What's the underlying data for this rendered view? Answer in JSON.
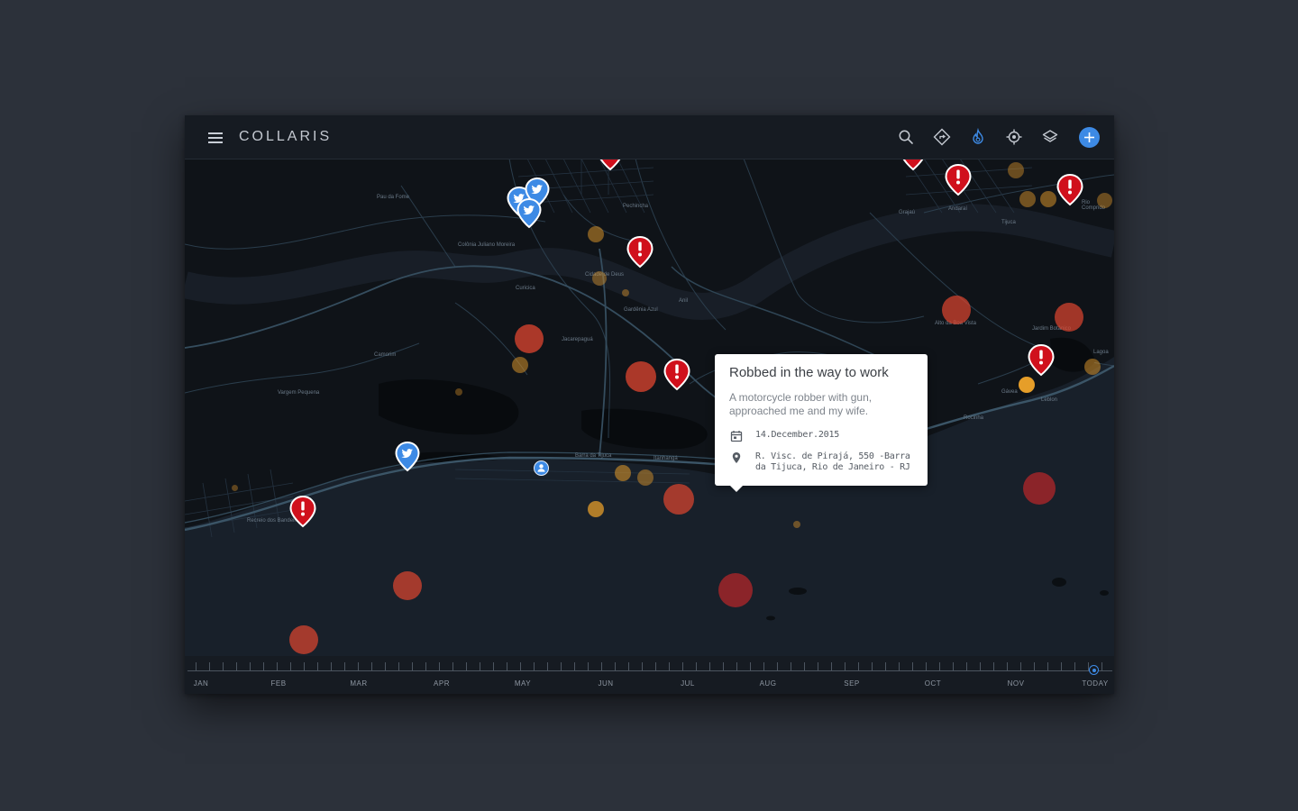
{
  "app": {
    "title": "COLLARIS"
  },
  "toolbar": {
    "icons": [
      "search-icon",
      "directions-icon",
      "fire-icon",
      "locate-icon",
      "layers-icon",
      "add-icon"
    ],
    "active_icon": "fire-icon",
    "accent_color": "#3d8ae5"
  },
  "map": {
    "place_labels": [
      "Pau da Fome",
      "Colônia Juliano Moreira",
      "Cidade de Deus",
      "Curicica",
      "Gardênia Azul",
      "Anil",
      "Jacarepaguá",
      "Camorim",
      "Vargem Pequena",
      "Recreio dos Bandeirantes",
      "Barra da Tijuca",
      "Joá",
      "Alto da Boa Vista",
      "Jardim Botânico",
      "Rocinha",
      "Gávea",
      "Leblon",
      "Lagoa",
      "Grajaú",
      "Andaraí",
      "Tijuca",
      "Rio Comprido",
      "Pechincha",
      "Taquara",
      "Itanhangá"
    ],
    "markers": {
      "incident_color": "#d0101c",
      "twitter_color": "#3d8ae5",
      "heat_colors": [
        "#e0462f",
        "#d6922a",
        "#f2a52a"
      ]
    }
  },
  "popup": {
    "title": "Robbed in the way to work",
    "description": "A motorcycle robber with gun, approached me and my wife.",
    "date": "14.December.2015",
    "address": "R. Visc. de Pirajá, 550 -Barra da Tijuca, Rio de Janeiro - RJ"
  },
  "timeline": {
    "labels": [
      "JAN",
      "FEB",
      "MAR",
      "APR",
      "MAY",
      "JUN",
      "JUL",
      "AUG",
      "SEP",
      "OCT",
      "NOV",
      "TODAY"
    ],
    "selected": "TODAY"
  }
}
